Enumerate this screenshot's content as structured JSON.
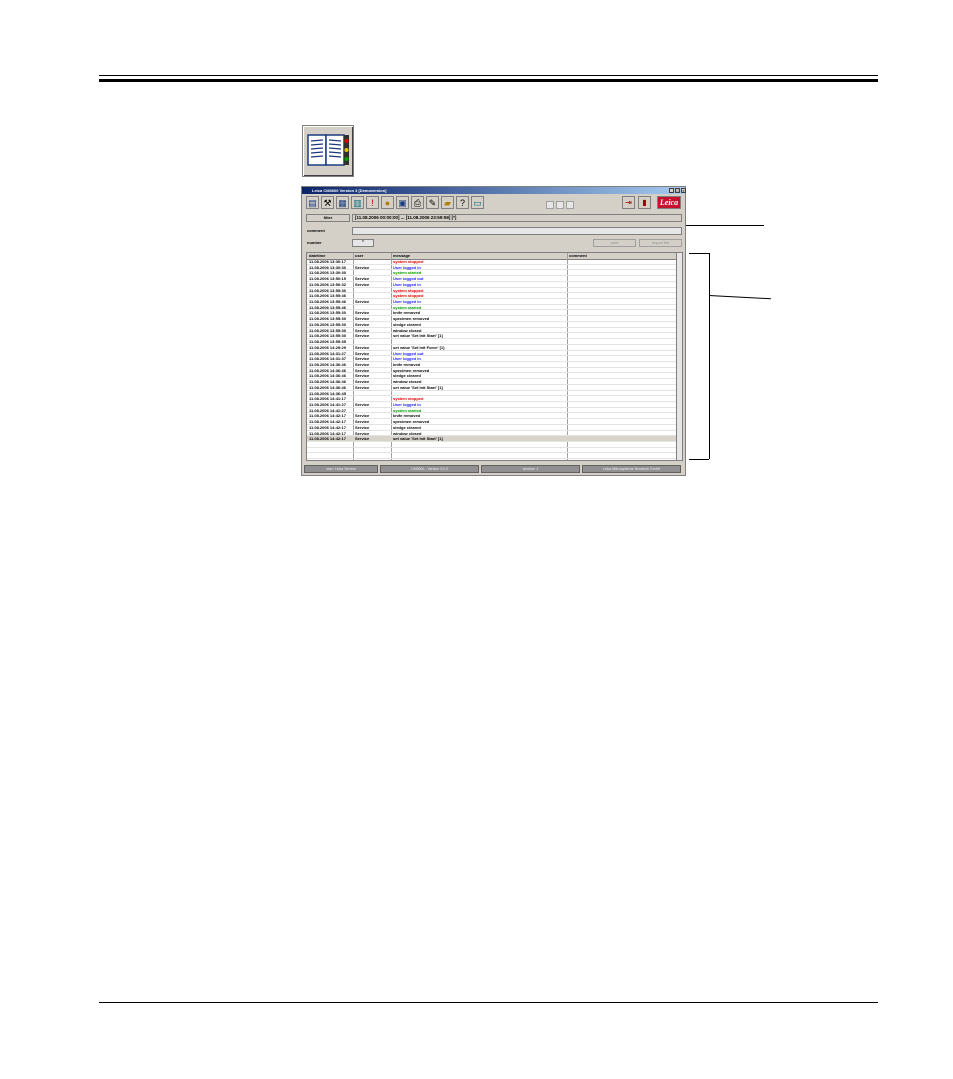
{
  "window": {
    "title": "Leica CM3600 Version 3 [Demoversion]"
  },
  "toolbar": {
    "icons": [
      "logbook-icon",
      "tools-icon",
      "chart-icon",
      "book-icon",
      "warning-icon",
      "lightbulb-icon",
      "save-icon",
      "print-icon",
      "paint-icon",
      "folder-icon",
      "help-icon",
      "monitor-icon"
    ],
    "help_glyph": "?",
    "warning_glyph": "!",
    "brand": "Leica"
  },
  "filter": {
    "button_label": "filter",
    "value": "[11.08.2006 00:00:00] ... [11.08.2006 23:59:59]  [*]"
  },
  "comment_label": "comment",
  "number_label": "number",
  "number_value": "*",
  "buttons": {
    "print": "print",
    "export": "export file"
  },
  "table": {
    "columns": [
      "datetime",
      "user",
      "message",
      "comment"
    ],
    "rows": [
      {
        "datetime": "11.08.2006 13:30:17",
        "user": "",
        "message": "system stopped",
        "status": "red"
      },
      {
        "datetime": "11.08.2006 13:30:30",
        "user": "Service",
        "message": "User logged in",
        "status": "blue"
      },
      {
        "datetime": "11.08.2006 13:30:30",
        "user": "",
        "message": "system started",
        "status": "green"
      },
      {
        "datetime": "11.08.2006 13:50:15",
        "user": "Service",
        "message": "User logged out",
        "status": "blue"
      },
      {
        "datetime": "11.08.2006 13:50:32",
        "user": "Service",
        "message": "User logged in",
        "status": "blue"
      },
      {
        "datetime": "11.08.2006 13:55:30",
        "user": "",
        "message": "system stopped",
        "status": "red"
      },
      {
        "datetime": "11.08.2006 13:55:46",
        "user": "",
        "message": "system stopped",
        "status": "red"
      },
      {
        "datetime": "11.08.2006 13:55:46",
        "user": "Service",
        "message": "User logged in",
        "status": "blue"
      },
      {
        "datetime": "11.08.2006 13:55:46",
        "user": "",
        "message": "system started",
        "status": "green"
      },
      {
        "datetime": "11.08.2006 13:55:30",
        "user": "Service",
        "message": "knife removed",
        "status": "black"
      },
      {
        "datetime": "11.08.2006 13:55:30",
        "user": "Service",
        "message": "specimen removed",
        "status": "black"
      },
      {
        "datetime": "11.08.2006 13:55:30",
        "user": "Service",
        "message": "sledge cleared",
        "status": "black"
      },
      {
        "datetime": "11.08.2006 13:55:30",
        "user": "Service",
        "message": "window closed",
        "status": "black"
      },
      {
        "datetime": "11.08.2006 13:55:30",
        "user": "Service",
        "message": "set value 'Set Init Start' [1]",
        "status": "black"
      },
      {
        "datetime": "11.08.2006 13:55:35",
        "user": "",
        "message": "",
        "status": "black"
      },
      {
        "datetime": "11.08.2006 14:25:29",
        "user": "Service",
        "message": "set value 'Set Init Force' [1]",
        "status": "black"
      },
      {
        "datetime": "11.08.2006 14:31:27",
        "user": "Service",
        "message": "User logged out",
        "status": "blue"
      },
      {
        "datetime": "11.08.2006 14:31:37",
        "user": "Service",
        "message": "User logged in",
        "status": "blue"
      },
      {
        "datetime": "11.08.2006 14:36:46",
        "user": "Service",
        "message": "knife removed",
        "status": "black"
      },
      {
        "datetime": "11.08.2006 14:36:46",
        "user": "Service",
        "message": "specimen removed",
        "status": "black"
      },
      {
        "datetime": "11.08.2006 14:36:46",
        "user": "Service",
        "message": "sledge cleared",
        "status": "black"
      },
      {
        "datetime": "11.08.2006 14:36:46",
        "user": "Service",
        "message": "window closed",
        "status": "black"
      },
      {
        "datetime": "11.08.2006 14:36:46",
        "user": "Service",
        "message": "set value 'Set Init Start' [1]",
        "status": "black"
      },
      {
        "datetime": "11.08.2006 14:36:45",
        "user": "",
        "message": "",
        "status": "black"
      },
      {
        "datetime": "11.08.2006 14:41:17",
        "user": "",
        "message": "system stopped",
        "status": "red"
      },
      {
        "datetime": "11.08.2006 14:41:27",
        "user": "Service",
        "message": "User logged in",
        "status": "blue"
      },
      {
        "datetime": "11.08.2006 14:41:27",
        "user": "",
        "message": "system started",
        "status": "green"
      },
      {
        "datetime": "11.08.2006 14:42:17",
        "user": "Service",
        "message": "knife removed",
        "status": "black"
      },
      {
        "datetime": "11.08.2006 14:42:17",
        "user": "Service",
        "message": "specimen removed",
        "status": "black"
      },
      {
        "datetime": "11.08.2006 14:42:17",
        "user": "Service",
        "message": "sledge cleared",
        "status": "black"
      },
      {
        "datetime": "11.08.2006 14:42:17",
        "user": "Service",
        "message": "window closed",
        "status": "black"
      },
      {
        "datetime": "11.08.2006 14:42:17",
        "user": "Service",
        "message": "set value 'Set Init Start' [1]",
        "status": "black",
        "selected": true
      }
    ]
  },
  "statusbar": {
    "user": "user:          Leica Service",
    "version": "CM3600 - Version 3.0.3",
    "window": "window:  1",
    "company": "Leica Mikrosysteme Nussloch GmbH"
  },
  "colors": {
    "red": "#e00000",
    "blue": "#1a1aff",
    "green": "#00a000",
    "black": "#000000",
    "brand": "#c8102e"
  }
}
